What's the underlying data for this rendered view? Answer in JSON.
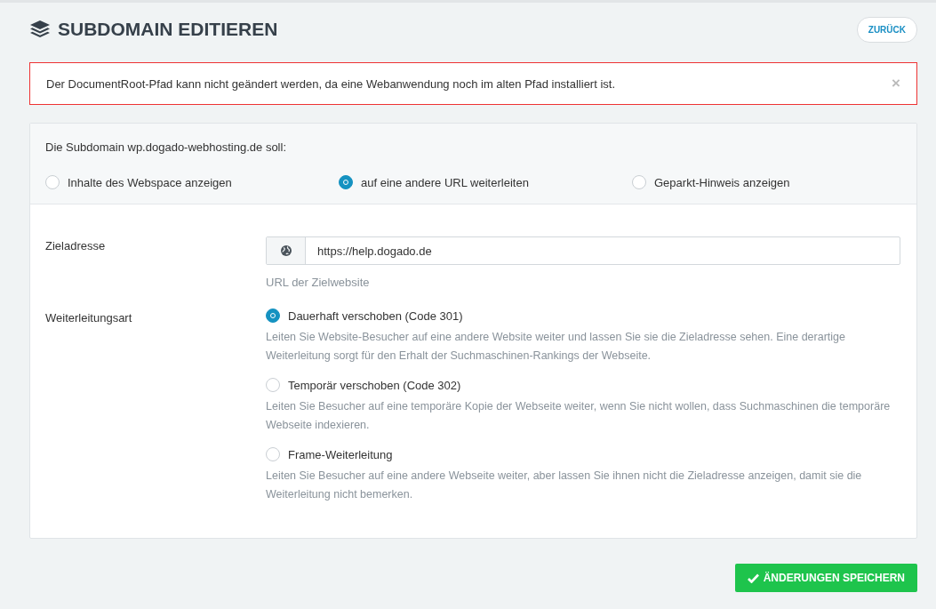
{
  "title": "SUBDOMAIN EDITIEREN",
  "back_button": "ZURÜCK",
  "alert": {
    "message": "Der DocumentRoot-Pfad kann nicht geändert werden, da eine Webanwendung noch im alten Pfad installiert ist.",
    "close": "×"
  },
  "mode": {
    "question": "Die Subdomain wp.dogado-webhosting.de soll:",
    "options": [
      {
        "label": "Inhalte des Webspace anzeigen",
        "selected": false
      },
      {
        "label": "auf eine andere URL weiterleiten",
        "selected": true
      },
      {
        "label": "Geparkt-Hinweis anzeigen",
        "selected": false
      }
    ]
  },
  "target": {
    "label": "Zieladresse",
    "value": "https://help.dogado.de",
    "help": "URL der Zielwebsite"
  },
  "redirect_type": {
    "label": "Weiterleitungsart",
    "options": [
      {
        "label": "Dauerhaft verschoben (Code 301)",
        "description": "Leiten Sie Website-Besucher auf eine andere Website weiter und lassen Sie sie die Zieladresse sehen. Eine derartige Weiterleitung sorgt für den Erhalt der Suchmaschinen-Rankings der Webseite.",
        "selected": true
      },
      {
        "label": "Temporär verschoben (Code 302)",
        "description": "Leiten Sie Besucher auf eine temporäre Kopie der Webseite weiter, wenn Sie nicht wollen, dass Suchmaschinen die temporäre Webseite indexieren.",
        "selected": false
      },
      {
        "label": "Frame-Weiterleitung",
        "description": "Leiten Sie Besucher auf eine andere Webseite weiter, aber lassen Sie ihnen nicht die Zieladresse anzeigen, damit sie die Weiterleitung nicht bemerken.",
        "selected": false
      }
    ]
  },
  "save_button": "ÄNDERUNGEN SPEICHERN"
}
